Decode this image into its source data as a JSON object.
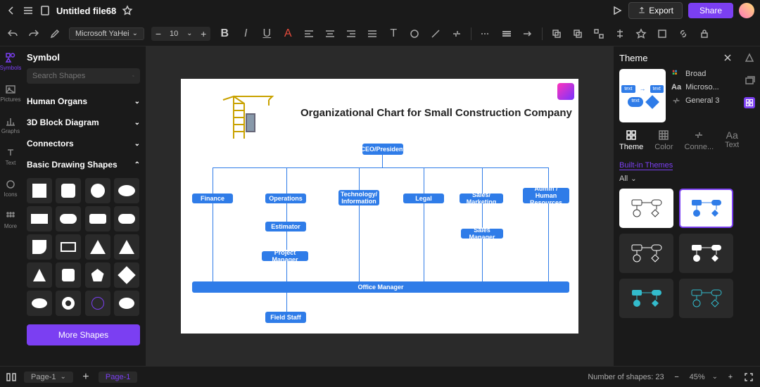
{
  "header": {
    "filename": "Untitled file68",
    "export_label": "Export",
    "share_label": "Share"
  },
  "toolbar": {
    "font": "Microsoft YaHei",
    "font_size": "10"
  },
  "leftnav": {
    "items": [
      {
        "label": "Symbols"
      },
      {
        "label": "Pictures"
      },
      {
        "label": "Graphs"
      },
      {
        "label": "Text"
      },
      {
        "label": "Icons"
      },
      {
        "label": "More"
      }
    ]
  },
  "sidebar": {
    "title": "Symbol",
    "search_placeholder": "Search Shapes",
    "categories": [
      {
        "label": "Human Organs"
      },
      {
        "label": "3D Block Diagram"
      },
      {
        "label": "Connectors"
      },
      {
        "label": "Basic Drawing Shapes"
      }
    ],
    "more_shapes_label": "More Shapes"
  },
  "canvas": {
    "title": "Organizational Chart for Small Construction Company",
    "nodes": {
      "ceo": "CEO/President",
      "finance": "Finance",
      "operations": "Operations",
      "tech": "Technology/ Information",
      "legal": "Legal",
      "sales": "Sales/ Marketing",
      "hr": "Admin / Human Resources",
      "estimator": "Estimator",
      "pm": "Project Manager",
      "sales_mgr": "Sales Manager",
      "office_mgr": "Office Manager",
      "field": "Field Staff"
    }
  },
  "theme": {
    "title": "Theme",
    "opts": {
      "broad": "Broad",
      "font": "Microso...",
      "general": "General 3"
    },
    "tabs": {
      "theme": "Theme",
      "color": "Color",
      "connector": "Conne...",
      "text": "Text"
    },
    "built_in": "Built-in Themes",
    "all": "All"
  },
  "statusbar": {
    "page_label": "Page-1",
    "shapes_label": "Number of shapes: 23",
    "zoom": "45%"
  },
  "chart_data": {
    "type": "org-chart",
    "title": "Organizational Chart for Small Construction Company",
    "root": "CEO/President",
    "children": [
      {
        "name": "Finance"
      },
      {
        "name": "Operations",
        "children": [
          {
            "name": "Estimator"
          },
          {
            "name": "Project Manager",
            "children": [
              {
                "name": "Field Staff"
              }
            ]
          }
        ]
      },
      {
        "name": "Technology/ Information"
      },
      {
        "name": "Legal"
      },
      {
        "name": "Sales/ Marketing",
        "children": [
          {
            "name": "Sales Manager"
          }
        ]
      },
      {
        "name": "Admin / Human Resources"
      }
    ],
    "spanning": [
      "Office Manager"
    ]
  }
}
